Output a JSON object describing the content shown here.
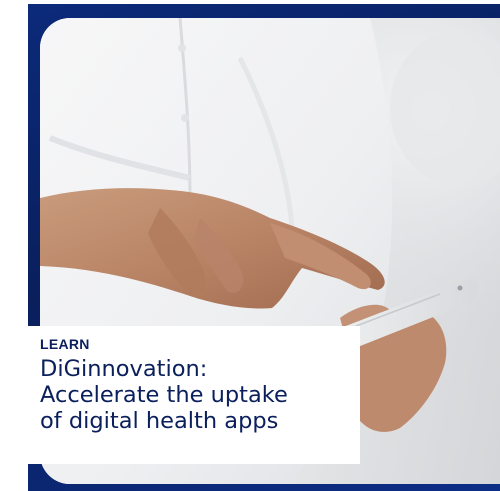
{
  "card": {
    "tag": "LEARN",
    "title_lines": [
      "DiGinnovation:",
      "Accelerate the uptake",
      "of digital health apps"
    ],
    "image": "hand-using-smartphone-photo"
  },
  "colors": {
    "navy": "#0a1f5c",
    "frame": "#0b2a7a",
    "caption_bg": "#ffffff"
  }
}
